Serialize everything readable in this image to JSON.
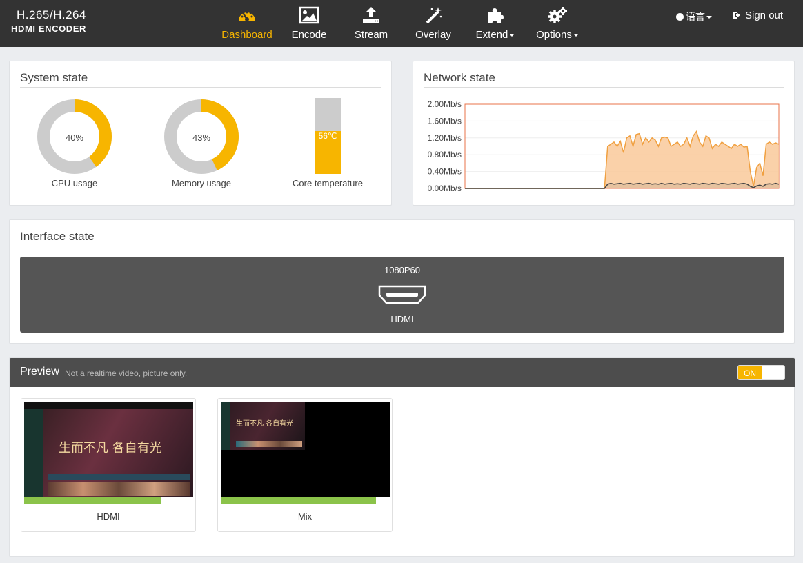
{
  "brand": {
    "line1": "H.265/H.264",
    "line2": "HDMI ENCODER"
  },
  "nav": [
    {
      "label": "Dashboard",
      "icon": "dashboard-gauge-icon",
      "active": true
    },
    {
      "label": "Encode",
      "icon": "picture-icon"
    },
    {
      "label": "Stream",
      "icon": "upload-icon"
    },
    {
      "label": "Overlay",
      "icon": "magic-wand-icon"
    },
    {
      "label": "Extend",
      "icon": "puzzle-icon",
      "dropdown": true
    },
    {
      "label": "Options",
      "icon": "gears-icon",
      "dropdown": true
    }
  ],
  "header_right": {
    "language": "语言",
    "signout": "Sign out"
  },
  "system_state": {
    "title": "System state",
    "cpu": {
      "value": "40%",
      "percent": 40,
      "label": "CPU usage"
    },
    "memory": {
      "value": "43%",
      "percent": 43,
      "label": "Memory usage"
    },
    "temperature": {
      "value": "56℃",
      "fill_fraction": 0.56,
      "label": "Core temperature"
    }
  },
  "network_state": {
    "title": "Network state"
  },
  "chart_data": {
    "type": "area",
    "title": "",
    "ylim": [
      0,
      2.0
    ],
    "yticks": [
      "2.00Mb/s",
      "1.60Mb/s",
      "1.20Mb/s",
      "0.80Mb/s",
      "0.40Mb/s",
      "0.00Mb/s"
    ],
    "ytick_values": [
      2.0,
      1.6,
      1.2,
      0.8,
      0.4,
      0.0
    ],
    "series": [
      {
        "values": [
          0,
          0,
          0,
          0,
          0,
          0,
          0,
          0,
          0,
          0,
          0,
          0,
          0,
          0,
          0,
          0,
          0,
          0,
          0,
          0,
          0,
          0,
          0,
          0,
          0,
          0,
          0,
          0,
          0,
          0,
          0,
          0,
          0,
          0,
          0,
          0,
          0,
          0,
          0,
          0,
          0,
          0,
          0,
          0,
          0,
          1.0,
          1.05,
          1.1,
          1.0,
          1.12,
          0.85,
          1.2,
          1.25,
          1.0,
          1.28,
          1.3,
          1.05,
          1.2,
          1.1,
          1.2,
          1.15,
          1.0,
          1.2,
          1.22,
          1.2,
          1.0,
          1.05,
          1.1,
          1.0,
          1.05,
          1.2,
          1.0,
          1.25,
          1.35,
          1.1,
          1.0,
          1.25,
          1.2,
          0.95,
          1.05,
          1.0,
          1.1,
          1.05,
          1.0,
          0.95,
          1.05,
          1.0,
          1.05,
          0.98,
          1.0,
          0.4,
          0.05,
          0.5,
          0.6,
          0.3,
          1.05,
          1.1,
          1.05,
          1.08,
          1.05
        ],
        "color": "#f0a040"
      },
      {
        "values": [
          0,
          0,
          0,
          0,
          0,
          0,
          0,
          0,
          0,
          0,
          0,
          0,
          0,
          0,
          0,
          0,
          0,
          0,
          0,
          0,
          0,
          0,
          0,
          0,
          0,
          0,
          0,
          0,
          0,
          0,
          0,
          0,
          0,
          0,
          0,
          0,
          0,
          0,
          0,
          0,
          0,
          0,
          0,
          0,
          0,
          0.1,
          0.12,
          0.1,
          0.11,
          0.12,
          0.1,
          0.11,
          0.12,
          0.1,
          0.11,
          0.12,
          0.1,
          0.11,
          0.12,
          0.1,
          0.11,
          0.1,
          0.12,
          0.1,
          0.11,
          0.12,
          0.1,
          0.11,
          0.1,
          0.12,
          0.11,
          0.1,
          0.12,
          0.11,
          0.1,
          0.12,
          0.11,
          0.1,
          0.12,
          0.11,
          0.1,
          0.12,
          0.11,
          0.1,
          0.11,
          0.12,
          0.1,
          0.11,
          0.12,
          0.1,
          0.05,
          0.02,
          0.06,
          0.08,
          0.05,
          0.1,
          0.11,
          0.1,
          0.12,
          0.1
        ],
        "color": "#444444"
      }
    ]
  },
  "interface_state": {
    "title": "Interface state",
    "resolution": "1080P60",
    "port": "HDMI",
    "port_icon": "hdmi-port-icon"
  },
  "preview": {
    "title": "Preview",
    "subtitle": "Not a realtime video, picture only.",
    "toggle": "ON",
    "thumbs": [
      {
        "label": "HDMI",
        "overlay_text": "生而不凡 各自有光",
        "level_fraction": 0.81
      },
      {
        "label": "Mix",
        "overlay_text": "生而不凡 各自有光",
        "level_fraction": 0.92
      }
    ]
  },
  "colors": {
    "accent": "#f7b500",
    "nav_bg": "#333333",
    "gauge_track": "#cccccc",
    "iface_bg": "#555555",
    "level_bar": "#8bc34a"
  }
}
